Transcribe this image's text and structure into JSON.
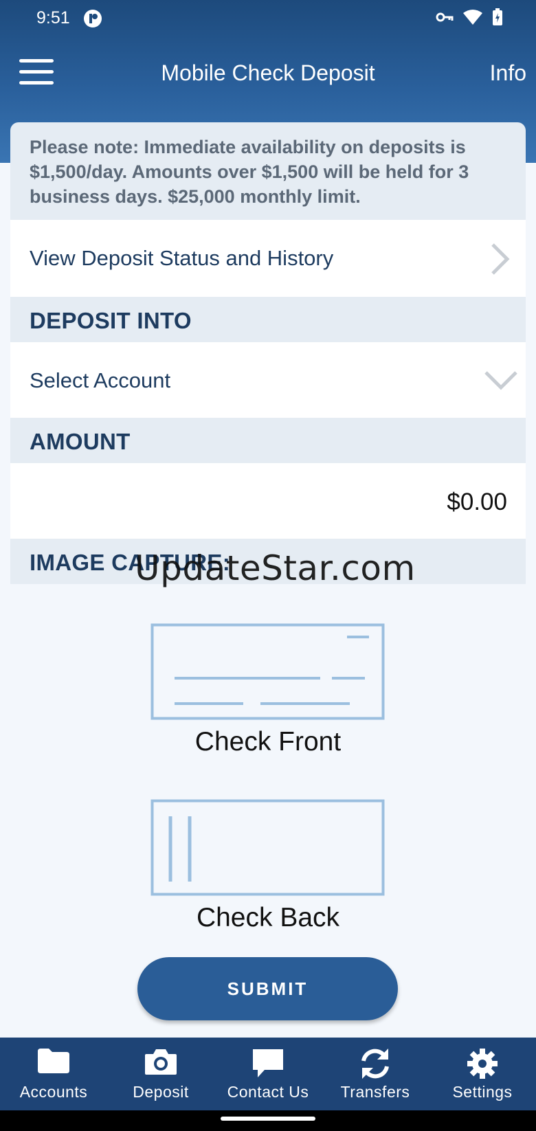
{
  "status_bar": {
    "time": "9:51"
  },
  "app_bar": {
    "title": "Mobile Check Deposit",
    "info": "Info"
  },
  "notice": {
    "text": "Please note: Immediate availability on deposits is $1,500/day. Amounts over $1,500 will be held for 3 business days. $25,000 monthly limit."
  },
  "history": {
    "label": "View Deposit Status and History"
  },
  "deposit_into": {
    "section": "DEPOSIT INTO",
    "placeholder": "Select Account"
  },
  "amount": {
    "section": "AMOUNT",
    "value": "$0.00"
  },
  "image_capture": {
    "section": "IMAGE CAPTURE:",
    "front_label": "Check Front",
    "back_label": "Check Back"
  },
  "watermark": "UpdateStar.com",
  "submit": {
    "label": "SUBMIT"
  },
  "bottom_nav": [
    {
      "label": "Accounts",
      "icon": "folder-icon"
    },
    {
      "label": "Deposit",
      "icon": "camera-icon"
    },
    {
      "label": "Contact Us",
      "icon": "chat-icon"
    },
    {
      "label": "Transfers",
      "icon": "refresh-icon"
    },
    {
      "label": "Settings",
      "icon": "gear-icon"
    }
  ],
  "colors": {
    "header": "#2a609c",
    "nav": "#1e4476",
    "accent": "#2a5d97",
    "check_outline": "#9bbfdf"
  }
}
